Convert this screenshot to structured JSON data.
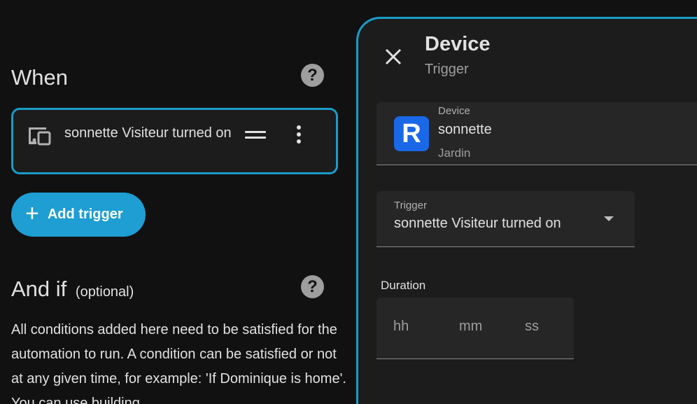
{
  "when": {
    "title": "When",
    "help_icon": "question-mark-icon",
    "trigger_card": {
      "icon": "devices-icon",
      "text": "sonnette Visiteur turned on",
      "drag_icon": "drag-handle-icon",
      "menu_icon": "dots-vertical-icon"
    },
    "add_trigger_label": "Add trigger"
  },
  "and_if": {
    "title": "And if",
    "optional": "(optional)",
    "description": "All conditions added here need to be satisfied for the automation to run. A condition can be satisfied or not at any given time, for example: 'If Dominique is home'. You can use building"
  },
  "dialog": {
    "title": "Device",
    "subtitle": "Trigger",
    "close_icon": "close-icon",
    "device_field": {
      "label": "Device",
      "name": "sonnette",
      "area": "Jardin",
      "logo_letter": "R"
    },
    "trigger_field": {
      "label": "Trigger",
      "value": "sonnette Visiteur turned on"
    },
    "duration": {
      "label": "Duration",
      "hours_placeholder": "hh",
      "minutes_placeholder": "mm",
      "seconds_placeholder": "ss"
    }
  },
  "colors": {
    "accent": "#1e9ed3",
    "border_accent": "#1a9bc7",
    "background": "#111111",
    "device_logo": "#1a68e8"
  }
}
